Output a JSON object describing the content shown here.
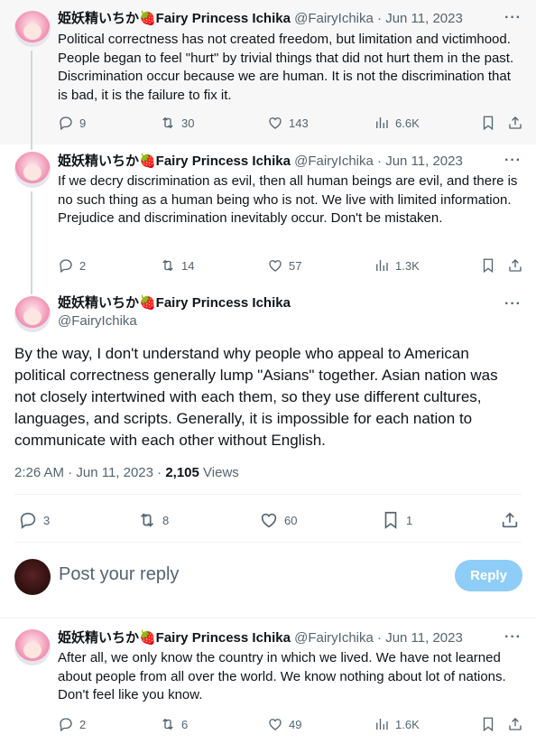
{
  "tweets": [
    {
      "display_name": "姫妖精いちか🍓Fairy Princess Ichika",
      "handle": "@FairyIchika",
      "date": "· Jun 11, 2023",
      "text": "Political correctness has not created freedom, but limitation and victimhood. People began to feel \"hurt\" by trivial things that did not hurt them in the past. Discrimination occur because we are human. It is not the discrimination that is bad, it is the failure to fix it.",
      "replies": "9",
      "reposts": "30",
      "likes": "143",
      "views": "6.6K"
    },
    {
      "display_name": "姫妖精いちか🍓Fairy Princess Ichika",
      "handle": "@FairyIchika",
      "date": "· Jun 11, 2023",
      "text": "If we decry discrimination as evil, then all human beings are evil, and there is no such thing as a human being who is not. We live with limited information. Prejudice and discrimination inevitably occur. Don't be mistaken.",
      "replies": "2",
      "reposts": "14",
      "likes": "57",
      "views": "1.3K"
    }
  ],
  "main_tweet": {
    "display_name": "姫妖精いちか🍓Fairy Princess Ichika",
    "handle": "@FairyIchika",
    "text": "By the way, I don't understand why people who appeal to American political correctness generally lump \"Asians\" together. Asian nation was not closely intertwined with each them, so they use different cultures, languages, and scripts. Generally, it is impossible for each nation to communicate with each other without English.",
    "time": "2:26 AM · Jun 11, 2023 · ",
    "views_count": "2,105",
    "views_label": " Views",
    "replies": "3",
    "reposts": "8",
    "likes": "60",
    "bookmarks": "1"
  },
  "reply_box": {
    "placeholder": "Post your reply",
    "button": "Reply"
  },
  "reply_tweet": {
    "display_name": "姫妖精いちか🍓Fairy Princess Ichika",
    "handle": "@FairyIchika",
    "date": "· Jun 11, 2023",
    "text": "After all, we only know the country in which we lived. We have not learned about people from all over the world. We know nothing about lot of nations. Don't feel like you know.",
    "replies": "2",
    "reposts": "6",
    "likes": "49",
    "views": "1.6K"
  },
  "more_label": "···",
  "icons": {
    "reply": "reply-icon",
    "repost": "repost-icon",
    "like": "heart-icon",
    "views": "views-icon",
    "bookmark": "bookmark-icon",
    "share": "share-icon",
    "more": "more-icon"
  },
  "colors": {
    "accent": "#1d9bf0",
    "reply_button": "#8ecdf7",
    "muted": "#536471"
  }
}
